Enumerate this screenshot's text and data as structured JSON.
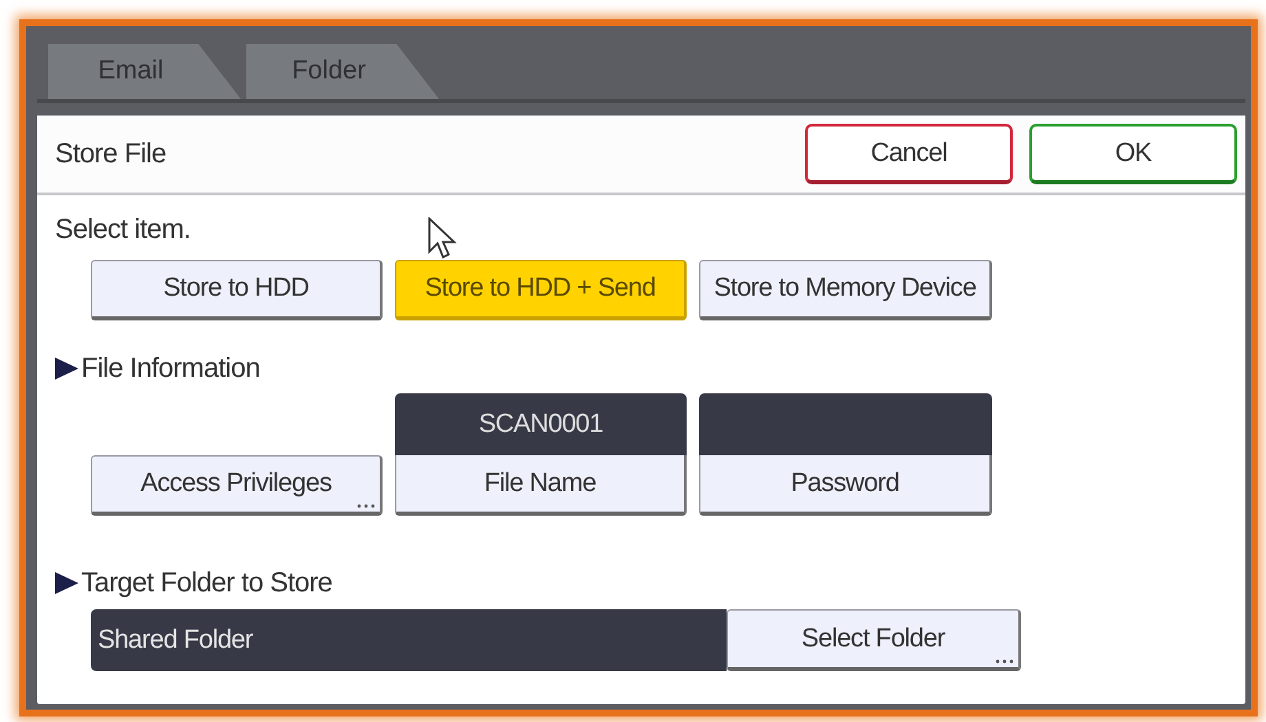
{
  "tabs": [
    {
      "label": "Email",
      "disabled": true
    },
    {
      "label": "Folder",
      "disabled": true
    }
  ],
  "header": {
    "title": "Store File",
    "buttons": [
      {
        "label": "Cancel",
        "kind": "cancel"
      },
      {
        "label": "OK",
        "kind": "ok"
      }
    ]
  },
  "select_item": {
    "prompt": "Select item.",
    "options": [
      {
        "label": "Store to HDD",
        "selected": false
      },
      {
        "label": "Store to HDD + Send",
        "selected": true
      },
      {
        "label": "Store to Memory Device",
        "selected": false
      }
    ]
  },
  "file_information": {
    "heading": "File Information",
    "items": [
      {
        "kind": "button",
        "label": "Access Privileges",
        "has_more": true
      },
      {
        "kind": "field",
        "value": "SCAN0001",
        "label": "File Name"
      },
      {
        "kind": "field",
        "label": "Password"
      }
    ]
  },
  "target_folder": {
    "heading": "Target Folder to Store",
    "value": "Shared Folder",
    "button": {
      "label": "Select Folder",
      "has_more": true
    }
  }
}
